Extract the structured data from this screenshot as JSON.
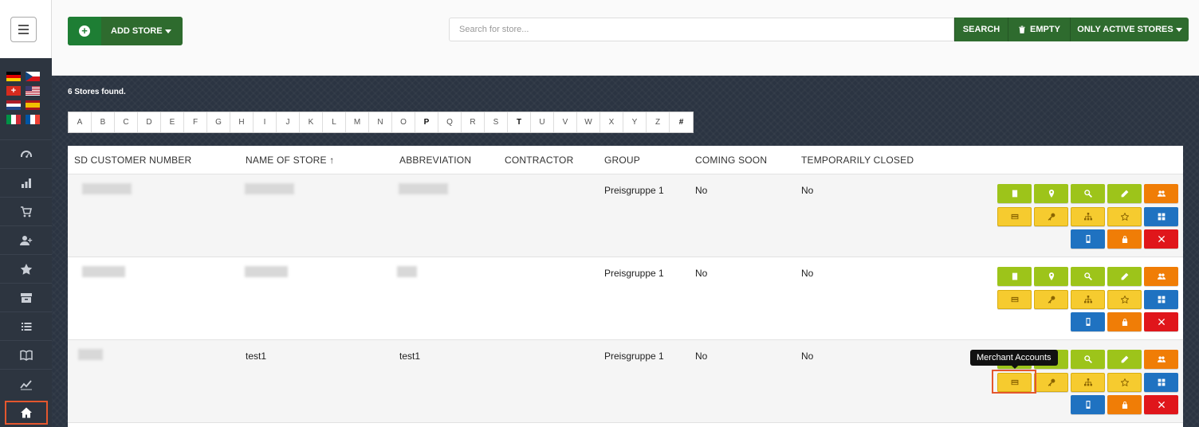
{
  "sidebar": {
    "menu_icon": "hamburger-menu-icon",
    "flags": [
      "de",
      "cz",
      "ch",
      "us",
      "nl",
      "es",
      "it",
      "fr"
    ],
    "nav_icons": [
      "dashboard-gauge-icon",
      "bar-chart-icon",
      "cart-icon",
      "user-plus-icon",
      "star-icon",
      "archive-icon",
      "list-icon",
      "book-icon",
      "trend-line-icon",
      "home-icon"
    ]
  },
  "toolbar": {
    "add_store_label": "ADD STORE",
    "search_placeholder": "Search for store...",
    "search_label": "SEARCH",
    "empty_label": "EMPTY",
    "active_label": "ONLY ACTIVE STORES"
  },
  "main": {
    "count_text": "6 Stores found.",
    "letters": [
      "A",
      "B",
      "C",
      "D",
      "E",
      "F",
      "G",
      "H",
      "I",
      "J",
      "K",
      "L",
      "M",
      "N",
      "O",
      "P",
      "Q",
      "R",
      "S",
      "T",
      "U",
      "V",
      "W",
      "X",
      "Y",
      "Z",
      "#"
    ],
    "bold_letters": [
      "P",
      "T",
      "#"
    ]
  },
  "table": {
    "headers": [
      "SD CUSTOMER NUMBER",
      "NAME OF STORE ↑",
      "ABBREVIATION",
      "CONTRACTOR",
      "GROUP",
      "COMING SOON",
      "TEMPORARILY CLOSED"
    ],
    "rows": [
      {
        "customer_number": "",
        "name": "",
        "abbreviation": "",
        "contractor": "",
        "group": "Preisgruppe 1",
        "coming_soon": "No",
        "temporarily_closed": "No"
      },
      {
        "customer_number": "",
        "name": "",
        "abbreviation": "",
        "contractor": "",
        "group": "Preisgruppe 1",
        "coming_soon": "No",
        "temporarily_closed": "No"
      },
      {
        "customer_number": "",
        "name": "test1",
        "abbreviation": "test1",
        "contractor": "",
        "group": "Preisgruppe 1",
        "coming_soon": "No",
        "temporarily_closed": "No"
      }
    ],
    "action_icons": [
      "document-icon",
      "map-pin-icon",
      "search-icon",
      "pencil-icon",
      "users-icon",
      "credit-card-icon",
      "key-icon",
      "sitemap-icon",
      "star-icon",
      "grid-icon",
      "mobile-icon",
      "lock-icon",
      "close-icon"
    ]
  },
  "tooltip": {
    "text": "Merchant Accounts"
  },
  "colors": {
    "sidebar": "#2d3540",
    "primary_green": "#2e6b2e",
    "lime": "#9dc41a",
    "yellow": "#f6cb2f",
    "orange": "#f07d06",
    "blue": "#1f72c1",
    "red": "#e0161b",
    "highlight": "#e4572e"
  }
}
